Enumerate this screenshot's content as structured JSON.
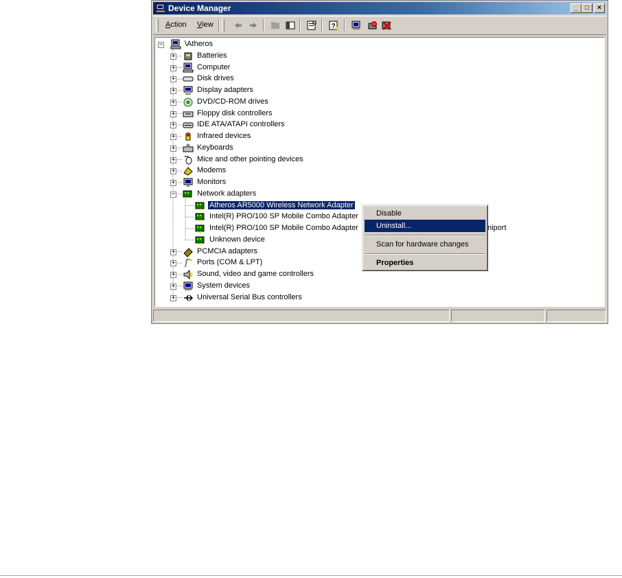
{
  "window": {
    "title": "Device Manager",
    "controls": {
      "minimize": "_",
      "maximize": "□",
      "close": "×"
    }
  },
  "toolbar": {
    "menu": [
      {
        "label": "Action",
        "underline": "A",
        "rest": "ction"
      },
      {
        "label": "View",
        "underline": "V",
        "rest": "iew"
      }
    ],
    "buttons": [
      "back-icon",
      "forward-icon",
      "up-icon",
      "show-hide-tree-icon",
      "properties-icon",
      "help-icon",
      "scan-hardware-icon",
      "disable-device-icon",
      "uninstall-device-icon"
    ]
  },
  "tree": {
    "root": "\\Atheros",
    "categories": [
      "Batteries",
      "Computer",
      "Disk drives",
      "Display adapters",
      "DVD/CD-ROM drives",
      "Floppy disk controllers",
      "IDE ATA/ATAPI controllers",
      "Infrared devices",
      "Keyboards",
      "Mice and other pointing devices",
      "Modems",
      "Monitors",
      "Network adapters"
    ],
    "network_children": [
      "Atheros AR5000 Wireless Network Adapter",
      "Intel(R) PRO/100 SP Mobile Combo Adapter",
      "Intel(R) PRO/100 SP Mobile Combo Adapter",
      "Unknown device"
    ],
    "partial_text": "niport",
    "more_categories": [
      "PCMCIA adapters",
      "Ports (COM & LPT)",
      "Sound, video and game controllers",
      "System devices",
      "Universal Serial Bus controllers"
    ]
  },
  "context_menu": {
    "items": [
      "Disable",
      "Uninstall...",
      "Scan for hardware changes",
      "Properties"
    ],
    "highlighted": "Uninstall..."
  }
}
